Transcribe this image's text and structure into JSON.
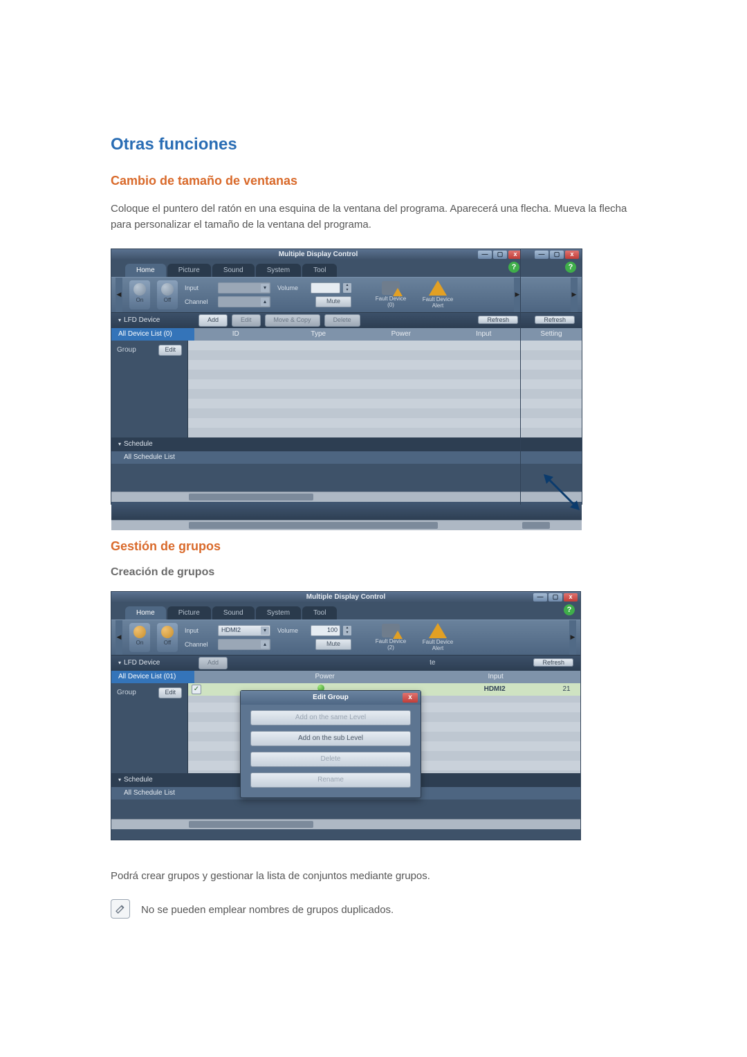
{
  "headings": {
    "main": "Otras funciones",
    "resize": "Cambio de tamaño de ventanas",
    "groups": "Gestión de grupos",
    "create_groups": "Creación de grupos"
  },
  "paragraphs": {
    "resize": "Coloque el puntero del ratón en una esquina de la ventana del programa. Aparecerá una flecha. Mueva la flecha para personalizar el tamaño de la ventana del programa.",
    "groups_intro": "Podrá crear grupos y gestionar la lista de conjuntos mediante grupos.",
    "note": "No se pueden emplear nombres de grupos duplicados."
  },
  "mdc": {
    "title": "Multiple Display Control",
    "help": "?",
    "winbtns": {
      "min": "—",
      "max": "▢",
      "close": "x"
    },
    "tabs": [
      "Home",
      "Picture",
      "Sound",
      "System",
      "Tool"
    ],
    "power": {
      "on": "On",
      "off": "Off"
    },
    "fields": {
      "input_label": "Input",
      "channel_label": "Channel",
      "volume_label": "Volume",
      "mute": "Mute"
    },
    "fault": {
      "device": "Fault Device",
      "alert": "Fault Device\nAlert"
    },
    "side_sections": {
      "lfd": "LFD Device",
      "all_devices_0": "All Device List (0)",
      "all_devices_1": "All Device List (01)",
      "group": "Group",
      "edit": "Edit",
      "schedule": "Schedule",
      "all_schedule": "All Schedule List"
    },
    "toolbar": {
      "add": "Add",
      "edit": "Edit",
      "move_copy": "Move & Copy",
      "delete": "Delete",
      "refresh": "Refresh"
    },
    "columns": {
      "id": "ID",
      "type": "Type",
      "power": "Power",
      "input": "Input",
      "setting": "Setting"
    },
    "columns2": {
      "te": "te",
      "power_col": "Power",
      "input_col": "Input"
    }
  },
  "shot1": {
    "input_value": "",
    "channel_value": "",
    "volume_value": "",
    "fault_count": "(0)"
  },
  "shot2": {
    "input_value": "HDMI2",
    "volume_value": "100",
    "fault_count": "(2)",
    "row": {
      "input": "HDMI2",
      "id": "21"
    },
    "edit_group": {
      "title": "Edit Group",
      "same_level": "Add on the same Level",
      "sub_level": "Add on the sub Level",
      "delete": "Delete",
      "rename": "Rename"
    }
  }
}
